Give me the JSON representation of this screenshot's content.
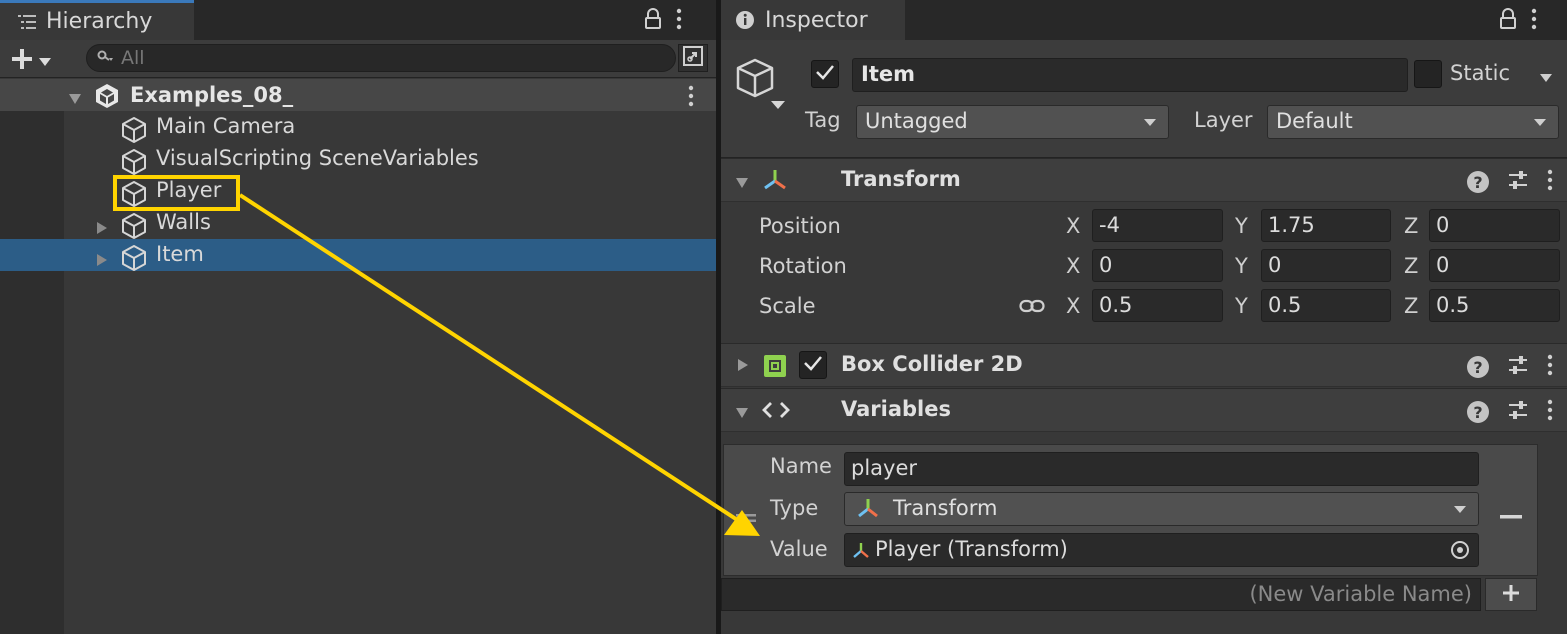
{
  "hierarchy": {
    "tab_label": "Hierarchy",
    "search_placeholder": "All",
    "scene_name": "Examples_08_",
    "items": [
      {
        "label": "Main Camera",
        "expandable": false,
        "selected": false
      },
      {
        "label": "VisualScripting SceneVariables",
        "expandable": false,
        "selected": false
      },
      {
        "label": "Player",
        "expandable": false,
        "selected": false,
        "highlighted": true
      },
      {
        "label": "Walls",
        "expandable": true,
        "selected": false
      },
      {
        "label": "Item",
        "expandable": true,
        "selected": true
      }
    ]
  },
  "inspector": {
    "tab_label": "Inspector",
    "object_name": "Item",
    "static_label": "Static",
    "tag_label": "Tag",
    "tag_value": "Untagged",
    "layer_label": "Layer",
    "layer_value": "Default",
    "transform": {
      "title": "Transform",
      "rows": [
        {
          "label": "Position",
          "x": "-4",
          "y": "1.75",
          "z": "0"
        },
        {
          "label": "Rotation",
          "x": "0",
          "y": "0",
          "z": "0"
        },
        {
          "label": "Scale",
          "x": "0.5",
          "y": "0.5",
          "z": "0.5"
        }
      ],
      "axis_labels": [
        "X",
        "Y",
        "Z"
      ]
    },
    "box_collider": {
      "title": "Box Collider 2D"
    },
    "variables": {
      "title": "Variables",
      "name_label": "Name",
      "name_value": "player",
      "type_label": "Type",
      "type_value": "Transform",
      "value_label": "Value",
      "value_value": "Player (Transform)",
      "new_variable_placeholder": "(New Variable Name)"
    }
  },
  "colors": {
    "selection": "#2c5d87",
    "highlight": "#ffd400",
    "panel": "#383838",
    "active_tab_accent": "#3a79bb"
  }
}
